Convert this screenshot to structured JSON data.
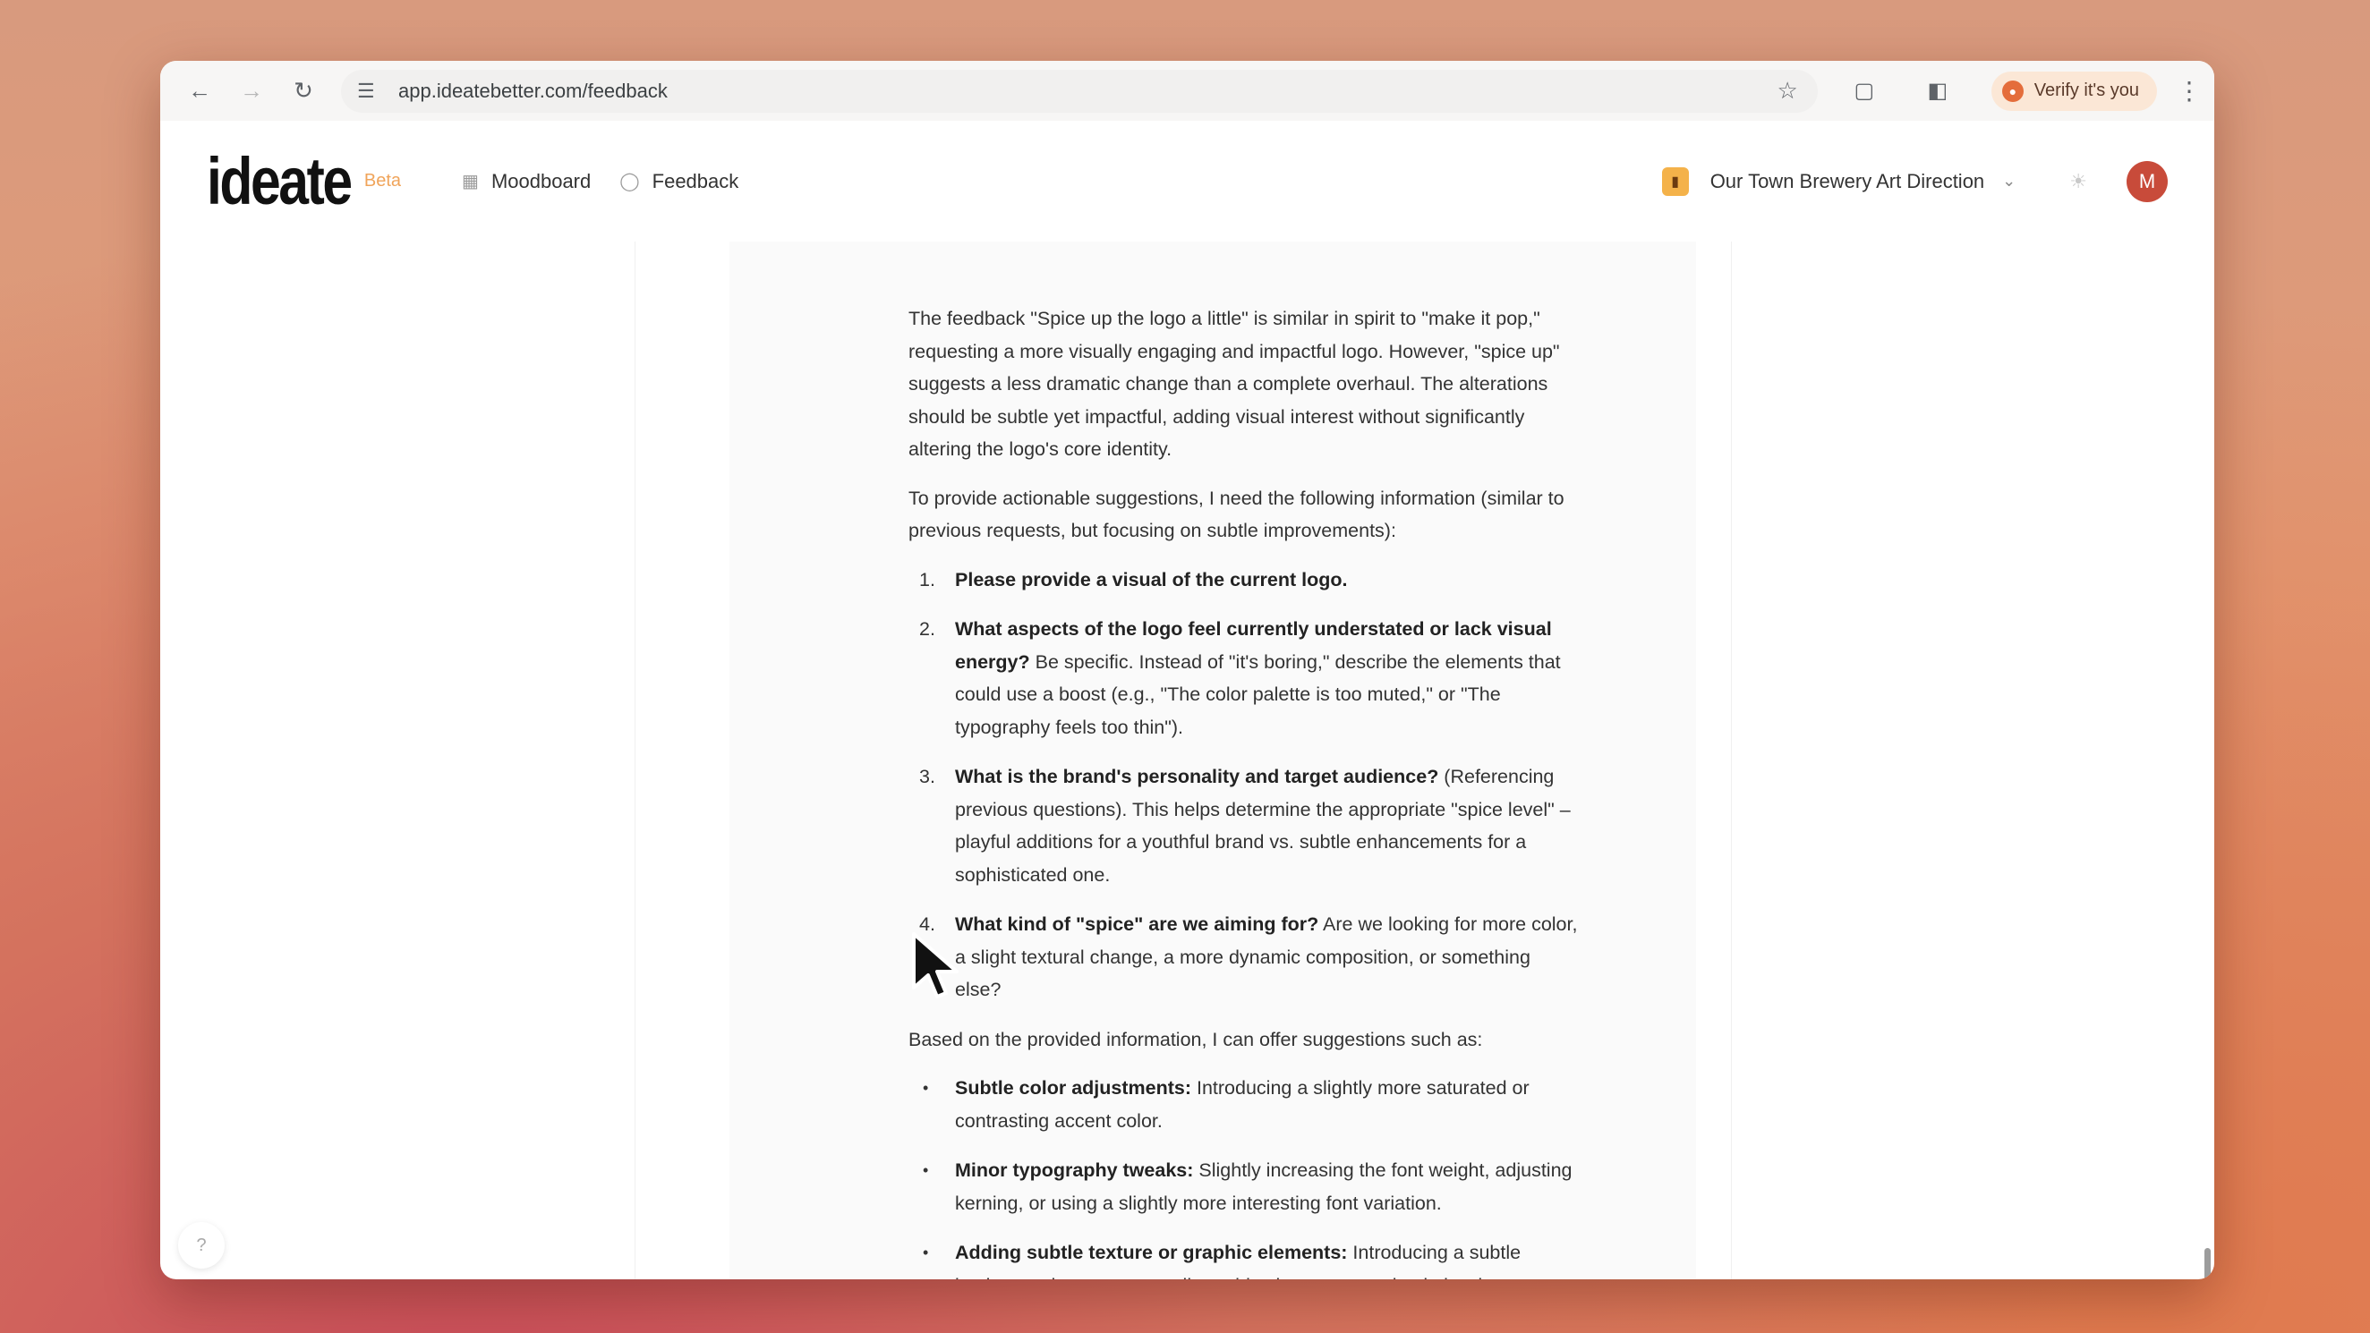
{
  "browser": {
    "url": "app.ideatebetter.com/feedback",
    "verify_label": "Verify it's you"
  },
  "app": {
    "logo": "ideate",
    "badge": "Beta",
    "tabs": [
      {
        "label": "Moodboard",
        "icon": "grid-icon"
      },
      {
        "label": "Feedback",
        "icon": "chat-bubble-icon"
      }
    ],
    "project": "Our Town Brewery Art Direction",
    "avatar_initial": "M",
    "help": "?"
  },
  "message": {
    "intro": "The feedback \"Spice up the logo a little\" is similar in spirit to \"make it pop,\" requesting a more visually engaging and impactful logo. However, \"spice up\" suggests a less dramatic change than a complete overhaul. The alterations should be subtle yet impactful, adding visual interest without significantly altering the logo's core identity.",
    "request": "To provide actionable suggestions, I need the following information (similar to previous requests, but focusing on subtle improvements):",
    "questions": [
      {
        "num": "1.",
        "bold": "Please provide a visual of the current logo.",
        "text": ""
      },
      {
        "num": "2.",
        "bold": "What aspects of the logo feel currently understated or lack visual energy?",
        "text": " Be specific. Instead of \"it's boring,\" describe the elements that could use a boost (e.g., \"The color palette is too muted,\" or \"The typography feels too thin\")."
      },
      {
        "num": "3.",
        "bold": "What is the brand's personality and target audience?",
        "text": " (Referencing previous questions). This helps determine the appropriate \"spice level\" – playful additions for a youthful brand vs. subtle enhancements for a sophisticated one."
      },
      {
        "num": "4.",
        "bold": "What kind of \"spice\" are we aiming for?",
        "text": " Are we looking for more color, a slight textural change, a more dynamic composition, or something else?"
      }
    ],
    "based_on": "Based on the provided information, I can offer suggestions such as:",
    "suggestions": [
      {
        "bold": "Subtle color adjustments:",
        "text": " Introducing a slightly more saturated or contrasting accent color."
      },
      {
        "bold": "Minor typography tweaks:",
        "text": " Slightly increasing the font weight, adjusting kerning, or using a slightly more interesting font variation."
      },
      {
        "bold": "Adding subtle texture or graphic elements:",
        "text": " Introducing a subtle background texture, a small graphic element, or a simple border"
      }
    ]
  },
  "colors": {
    "beta": "#f0a45a",
    "avatar": "#c84b3a",
    "project_icon": "#f4b24a"
  }
}
